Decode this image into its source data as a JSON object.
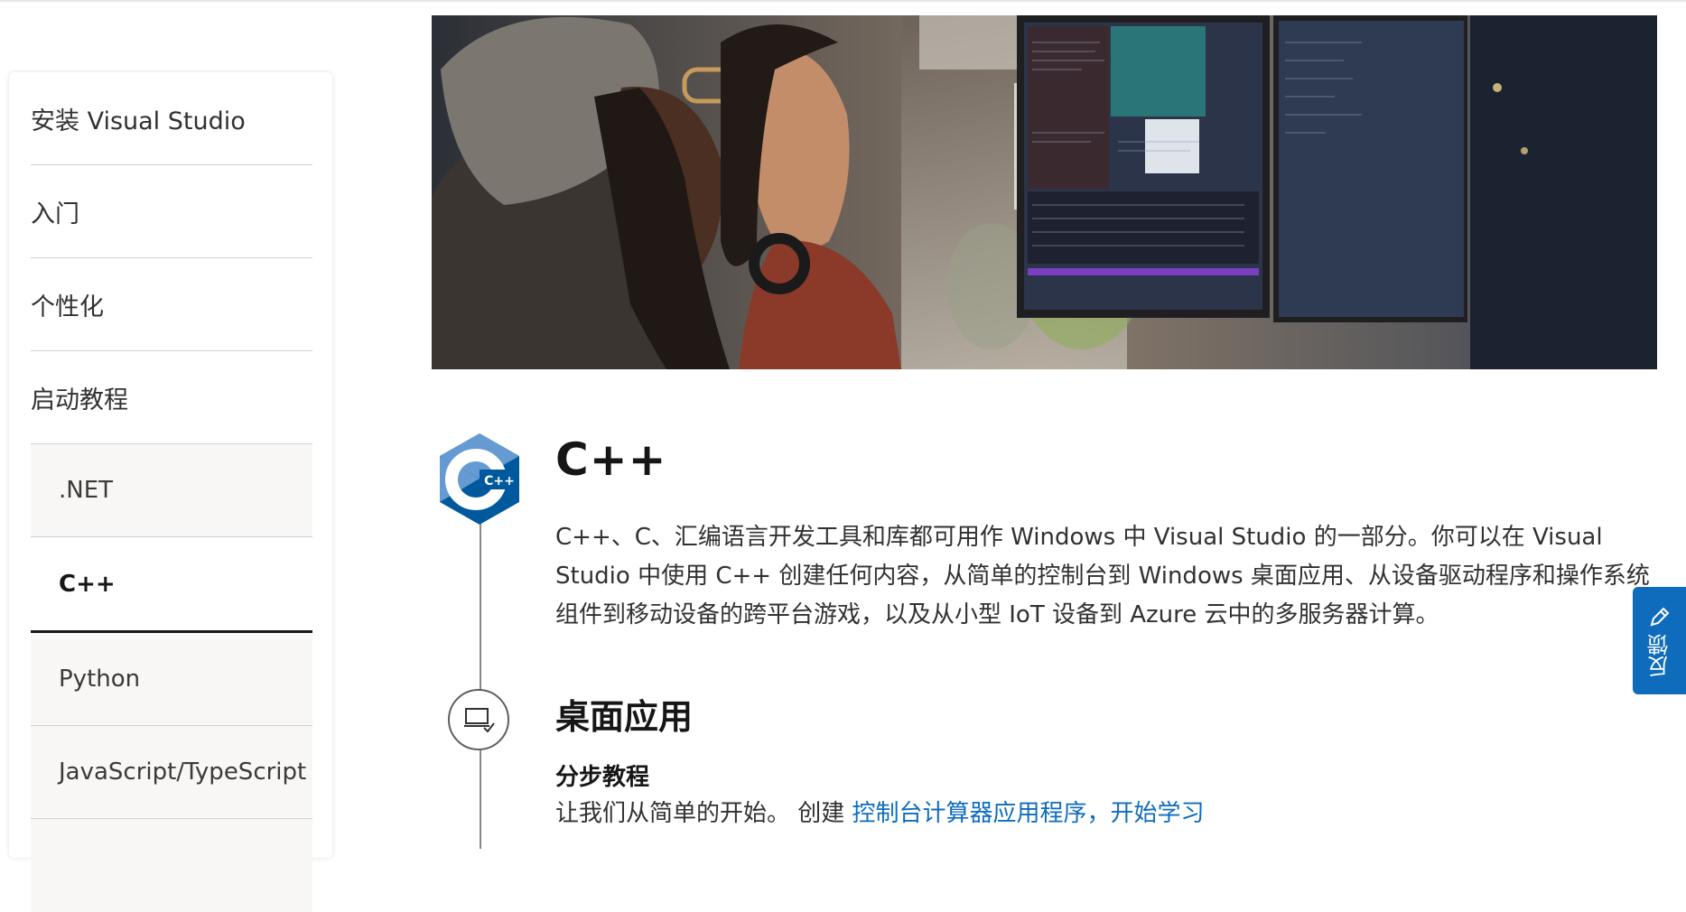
{
  "sidebar": {
    "items": [
      {
        "label": "安装 Visual Studio"
      },
      {
        "label": "入门"
      },
      {
        "label": "个性化"
      },
      {
        "label": "启动教程"
      },
      {
        "label": ".NET"
      },
      {
        "label": "C++"
      },
      {
        "label": "Python"
      },
      {
        "label": "JavaScript/TypeScript"
      }
    ]
  },
  "main": {
    "cpp": {
      "title": "C++",
      "description": "C++、C、汇编语言开发工具和库都可用作 Windows 中 Visual Studio 的一部分。你可以在 Visual Studio 中使用 C++ 创建任何内容，从简单的控制台到 Windows 桌面应用、从设备驱动程序和操作系统组件到移动设备的跨平台游戏，以及从小型 IoT 设备到 Azure 云中的多服务器计算。",
      "logo_text": "C++"
    },
    "desktop": {
      "title": "桌面应用",
      "subtitle": "分步教程",
      "text": "让我们从简单的开始。 创建 ",
      "link": "控制台计算器应用程序，开始学习"
    }
  },
  "feedback": {
    "label": "反馈"
  },
  "colors": {
    "accent": "#0f6cbd",
    "cpp_logo_light": "#659ad2",
    "cpp_logo_dark": "#00599c"
  }
}
